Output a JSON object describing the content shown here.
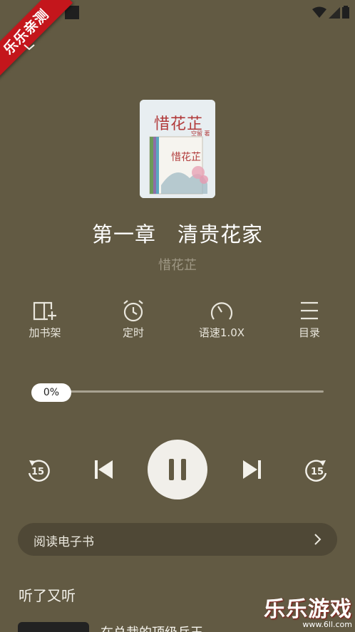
{
  "status_bar": {
    "icons": [
      "wifi-icon",
      "signal-icon",
      "battery-icon"
    ]
  },
  "ribbon": {
    "text": "乐乐亲测"
  },
  "cover": {
    "title": "惜花芷",
    "author": "空留 著"
  },
  "player": {
    "chapter_title": "第一章　清贵花家",
    "book_name": "惜花芷",
    "progress_percent": 0,
    "progress_label": "0%"
  },
  "actions": [
    {
      "label": "加书架",
      "icon": "add-to-shelf-icon"
    },
    {
      "label": "定时",
      "icon": "alarm-clock-icon"
    },
    {
      "label": "语速1.0X",
      "icon": "speed-gauge-icon"
    },
    {
      "label": "目录",
      "icon": "menu-list-icon"
    }
  ],
  "controls": {
    "rewind_seconds": "15",
    "forward_seconds": "15"
  },
  "read_ebook": {
    "label": "阅读电子书"
  },
  "recommend": {
    "section_title": "听了又听",
    "first_item_title": "在总裁的顶级兵王"
  },
  "watermark": {
    "main": "乐乐游戏",
    "sub": "www.6ll.com"
  },
  "colors": {
    "background": "#625a43",
    "ribbon": "#c4161c",
    "read_bar": "#4f4836"
  }
}
